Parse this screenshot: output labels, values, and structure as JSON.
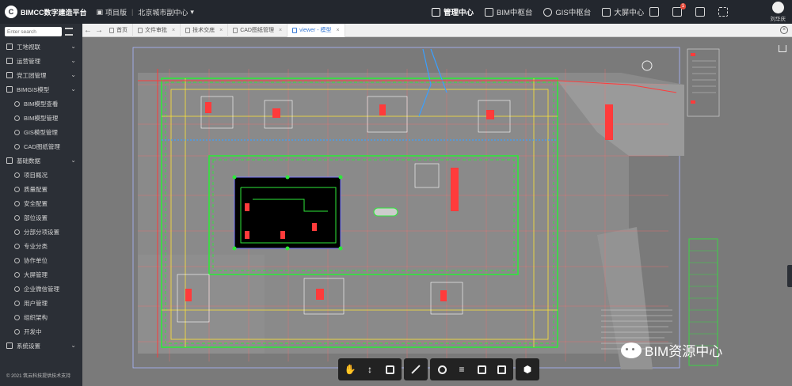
{
  "header": {
    "logo_text": "BIMCC数字建造平台",
    "project_label": "项目版",
    "project_name": "北京城市副中心",
    "nav": [
      {
        "label": "管理中心",
        "active": true
      },
      {
        "label": "BIM中枢台",
        "active": false
      },
      {
        "label": "GIS中枢台",
        "active": false
      },
      {
        "label": "大屏中心",
        "active": false
      }
    ],
    "notification_count": "1",
    "username": "刘华庆"
  },
  "sidebar": {
    "search_placeholder": "Enter search",
    "items": [
      {
        "label": "工地视联",
        "type": "group"
      },
      {
        "label": "运营管理",
        "type": "group"
      },
      {
        "label": "党工团管理",
        "type": "group"
      },
      {
        "label": "BIMGIS模型",
        "type": "group"
      },
      {
        "label": "BIM模型查看",
        "type": "sub"
      },
      {
        "label": "BIM模型管理",
        "type": "sub"
      },
      {
        "label": "GIS模型管理",
        "type": "sub"
      },
      {
        "label": "CAD图纸管理",
        "type": "sub"
      },
      {
        "label": "基础数据",
        "type": "group"
      },
      {
        "label": "项目概况",
        "type": "sub"
      },
      {
        "label": "质量配置",
        "type": "sub"
      },
      {
        "label": "安全配置",
        "type": "sub"
      },
      {
        "label": "部位设置",
        "type": "sub"
      },
      {
        "label": "分部分项设置",
        "type": "sub"
      },
      {
        "label": "专业分类",
        "type": "sub"
      },
      {
        "label": "协作单位",
        "type": "sub"
      },
      {
        "label": "大屏管理",
        "type": "sub"
      },
      {
        "label": "企业微信管理",
        "type": "sub"
      },
      {
        "label": "用户管理",
        "type": "sub"
      },
      {
        "label": "组织架构",
        "type": "sub"
      },
      {
        "label": "开发中",
        "type": "sub"
      },
      {
        "label": "系统设置",
        "type": "group"
      }
    ],
    "copyright": "© 2021 筑云科技提供技术支持"
  },
  "tabs": [
    {
      "label": "首页",
      "active": false,
      "closable": false
    },
    {
      "label": "文件审批",
      "active": false,
      "closable": true
    },
    {
      "label": "技术交底",
      "active": false,
      "closable": true
    },
    {
      "label": "CAD图纸管理",
      "active": false,
      "closable": true
    },
    {
      "label": "viewer - 模型",
      "active": true,
      "closable": true
    }
  ],
  "watermark": "BIM资源中心",
  "colors": {
    "accent": "#3a7bd5",
    "viewer_bg": "#7a7a7a",
    "cad_green": "#2ee83a",
    "cad_red": "#ff3b3b",
    "cad_yellow": "#ffe533"
  }
}
